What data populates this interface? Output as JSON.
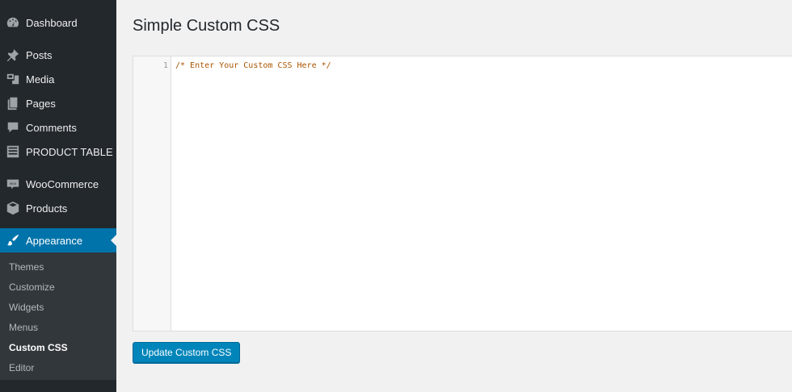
{
  "sidebar": {
    "items": [
      {
        "label": "Dashboard",
        "icon": "dashboard-icon"
      },
      {
        "label": "Posts",
        "icon": "pin-icon"
      },
      {
        "label": "Media",
        "icon": "media-icon"
      },
      {
        "label": "Pages",
        "icon": "pages-icon"
      },
      {
        "label": "Comments",
        "icon": "comment-icon"
      },
      {
        "label": "PRODUCT TABLE",
        "icon": "table-icon"
      },
      {
        "label": "WooCommerce",
        "icon": "woocommerce-icon"
      },
      {
        "label": "Products",
        "icon": "box-icon"
      },
      {
        "label": "Appearance",
        "icon": "brush-icon"
      }
    ],
    "submenu": [
      "Themes",
      "Customize",
      "Widgets",
      "Menus",
      "Custom CSS",
      "Editor"
    ]
  },
  "main": {
    "title": "Simple Custom CSS",
    "editor": {
      "line_number": "1",
      "code": "/* Enter Your Custom CSS Here */"
    },
    "update_button": "Update Custom CSS"
  },
  "colors": {
    "sidebar_bg": "#23282d",
    "accent": "#0073aa",
    "button": "#0085ba",
    "comment_text": "#aa5500"
  }
}
